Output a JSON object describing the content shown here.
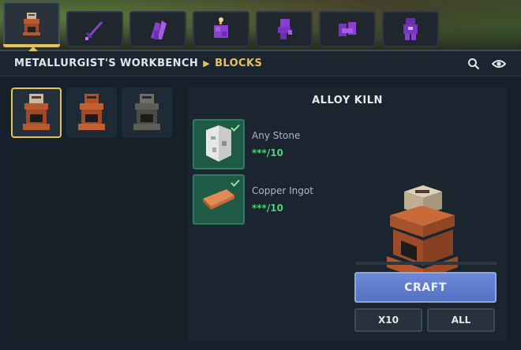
{
  "tabs": [
    {
      "name": "kiln-category-icon",
      "active": true
    },
    {
      "name": "sword-category-icon",
      "active": false
    },
    {
      "name": "crystal-category-icon",
      "active": false
    },
    {
      "name": "potion-category-icon",
      "active": false
    },
    {
      "name": "statue-category-icon",
      "active": false
    },
    {
      "name": "block-category-icon",
      "active": false
    },
    {
      "name": "armor-category-icon",
      "active": false
    }
  ],
  "header": {
    "workbench": "METALLURGIST'S WORKBENCH",
    "separator": "▶",
    "category": "BLOCKS",
    "search_icon": "search-icon",
    "view_icon": "eye-icon"
  },
  "grid": {
    "items": [
      {
        "name": "alloy-kiln",
        "selected": true
      },
      {
        "name": "copper-kiln",
        "selected": false
      },
      {
        "name": "iron-kiln",
        "selected": false
      }
    ]
  },
  "detail": {
    "title": "ALLOY KILN",
    "ingredients": [
      {
        "name": "Any Stone",
        "count": "***/10",
        "icon": "stone-icon",
        "satisfied": true
      },
      {
        "name": "Copper Ingot",
        "count": "***/10",
        "icon": "copper-ingot-icon",
        "satisfied": true
      }
    ],
    "progress": 0.0,
    "craft_label": "CRAFT",
    "x10_label": "X10",
    "all_label": "ALL"
  },
  "colors": {
    "accent": "#e6c25a",
    "craft": "#5f7dcc",
    "ingredient_bg": "#1f5a47",
    "count_green": "#4fd17a"
  }
}
